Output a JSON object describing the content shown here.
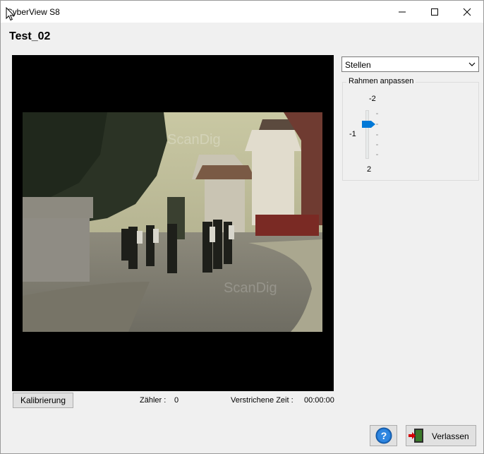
{
  "window": {
    "title": "CyberView S8"
  },
  "document": {
    "title": "Test_02"
  },
  "viewer": {
    "watermark": "ScanDig"
  },
  "bottom": {
    "calibration_label": "Kalibrierung",
    "counter_label": "Zähler :",
    "counter_value": "0",
    "elapsed_label": "Verstrichene Zeit :",
    "elapsed_value": "00:00:00"
  },
  "controls": {
    "mode_selected": "Stellen",
    "frame_group_title": "Rahmen anpassen",
    "slider_max_label": "-2",
    "slider_current_label": "-1",
    "slider_min_label": "2"
  },
  "footer": {
    "help_label": "?",
    "exit_label": "Verlassen"
  },
  "colors": {
    "accent": "#0078d7",
    "viewer_bg": "#000000"
  },
  "icons": {
    "minimize": "minimize-icon",
    "maximize": "maximize-icon",
    "close": "close-icon",
    "help": "help-icon",
    "exit": "exit-door-icon"
  }
}
